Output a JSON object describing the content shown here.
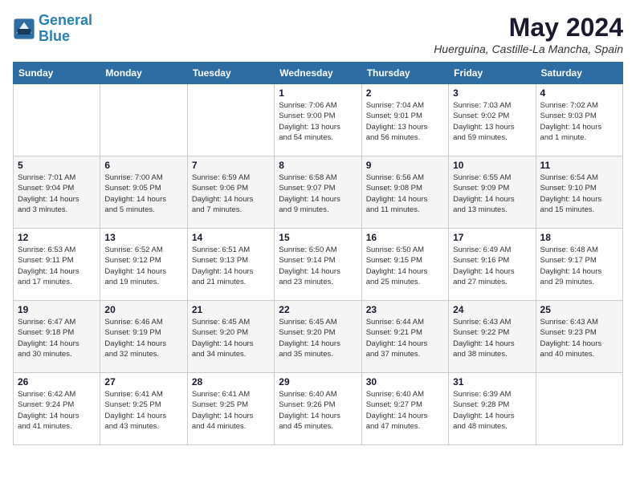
{
  "logo": {
    "line1": "General",
    "line2": "Blue"
  },
  "title": "May 2024",
  "location": "Huerguina, Castille-La Mancha, Spain",
  "days_of_week": [
    "Sunday",
    "Monday",
    "Tuesday",
    "Wednesday",
    "Thursday",
    "Friday",
    "Saturday"
  ],
  "weeks": [
    [
      {
        "day": "",
        "info": ""
      },
      {
        "day": "",
        "info": ""
      },
      {
        "day": "",
        "info": ""
      },
      {
        "day": "1",
        "info": "Sunrise: 7:06 AM\nSunset: 9:00 PM\nDaylight: 13 hours\nand 54 minutes."
      },
      {
        "day": "2",
        "info": "Sunrise: 7:04 AM\nSunset: 9:01 PM\nDaylight: 13 hours\nand 56 minutes."
      },
      {
        "day": "3",
        "info": "Sunrise: 7:03 AM\nSunset: 9:02 PM\nDaylight: 13 hours\nand 59 minutes."
      },
      {
        "day": "4",
        "info": "Sunrise: 7:02 AM\nSunset: 9:03 PM\nDaylight: 14 hours\nand 1 minute."
      }
    ],
    [
      {
        "day": "5",
        "info": "Sunrise: 7:01 AM\nSunset: 9:04 PM\nDaylight: 14 hours\nand 3 minutes."
      },
      {
        "day": "6",
        "info": "Sunrise: 7:00 AM\nSunset: 9:05 PM\nDaylight: 14 hours\nand 5 minutes."
      },
      {
        "day": "7",
        "info": "Sunrise: 6:59 AM\nSunset: 9:06 PM\nDaylight: 14 hours\nand 7 minutes."
      },
      {
        "day": "8",
        "info": "Sunrise: 6:58 AM\nSunset: 9:07 PM\nDaylight: 14 hours\nand 9 minutes."
      },
      {
        "day": "9",
        "info": "Sunrise: 6:56 AM\nSunset: 9:08 PM\nDaylight: 14 hours\nand 11 minutes."
      },
      {
        "day": "10",
        "info": "Sunrise: 6:55 AM\nSunset: 9:09 PM\nDaylight: 14 hours\nand 13 minutes."
      },
      {
        "day": "11",
        "info": "Sunrise: 6:54 AM\nSunset: 9:10 PM\nDaylight: 14 hours\nand 15 minutes."
      }
    ],
    [
      {
        "day": "12",
        "info": "Sunrise: 6:53 AM\nSunset: 9:11 PM\nDaylight: 14 hours\nand 17 minutes."
      },
      {
        "day": "13",
        "info": "Sunrise: 6:52 AM\nSunset: 9:12 PM\nDaylight: 14 hours\nand 19 minutes."
      },
      {
        "day": "14",
        "info": "Sunrise: 6:51 AM\nSunset: 9:13 PM\nDaylight: 14 hours\nand 21 minutes."
      },
      {
        "day": "15",
        "info": "Sunrise: 6:50 AM\nSunset: 9:14 PM\nDaylight: 14 hours\nand 23 minutes."
      },
      {
        "day": "16",
        "info": "Sunrise: 6:50 AM\nSunset: 9:15 PM\nDaylight: 14 hours\nand 25 minutes."
      },
      {
        "day": "17",
        "info": "Sunrise: 6:49 AM\nSunset: 9:16 PM\nDaylight: 14 hours\nand 27 minutes."
      },
      {
        "day": "18",
        "info": "Sunrise: 6:48 AM\nSunset: 9:17 PM\nDaylight: 14 hours\nand 29 minutes."
      }
    ],
    [
      {
        "day": "19",
        "info": "Sunrise: 6:47 AM\nSunset: 9:18 PM\nDaylight: 14 hours\nand 30 minutes."
      },
      {
        "day": "20",
        "info": "Sunrise: 6:46 AM\nSunset: 9:19 PM\nDaylight: 14 hours\nand 32 minutes."
      },
      {
        "day": "21",
        "info": "Sunrise: 6:45 AM\nSunset: 9:20 PM\nDaylight: 14 hours\nand 34 minutes."
      },
      {
        "day": "22",
        "info": "Sunrise: 6:45 AM\nSunset: 9:20 PM\nDaylight: 14 hours\nand 35 minutes."
      },
      {
        "day": "23",
        "info": "Sunrise: 6:44 AM\nSunset: 9:21 PM\nDaylight: 14 hours\nand 37 minutes."
      },
      {
        "day": "24",
        "info": "Sunrise: 6:43 AM\nSunset: 9:22 PM\nDaylight: 14 hours\nand 38 minutes."
      },
      {
        "day": "25",
        "info": "Sunrise: 6:43 AM\nSunset: 9:23 PM\nDaylight: 14 hours\nand 40 minutes."
      }
    ],
    [
      {
        "day": "26",
        "info": "Sunrise: 6:42 AM\nSunset: 9:24 PM\nDaylight: 14 hours\nand 41 minutes."
      },
      {
        "day": "27",
        "info": "Sunrise: 6:41 AM\nSunset: 9:25 PM\nDaylight: 14 hours\nand 43 minutes."
      },
      {
        "day": "28",
        "info": "Sunrise: 6:41 AM\nSunset: 9:25 PM\nDaylight: 14 hours\nand 44 minutes."
      },
      {
        "day": "29",
        "info": "Sunrise: 6:40 AM\nSunset: 9:26 PM\nDaylight: 14 hours\nand 45 minutes."
      },
      {
        "day": "30",
        "info": "Sunrise: 6:40 AM\nSunset: 9:27 PM\nDaylight: 14 hours\nand 47 minutes."
      },
      {
        "day": "31",
        "info": "Sunrise: 6:39 AM\nSunset: 9:28 PM\nDaylight: 14 hours\nand 48 minutes."
      },
      {
        "day": "",
        "info": ""
      }
    ]
  ]
}
